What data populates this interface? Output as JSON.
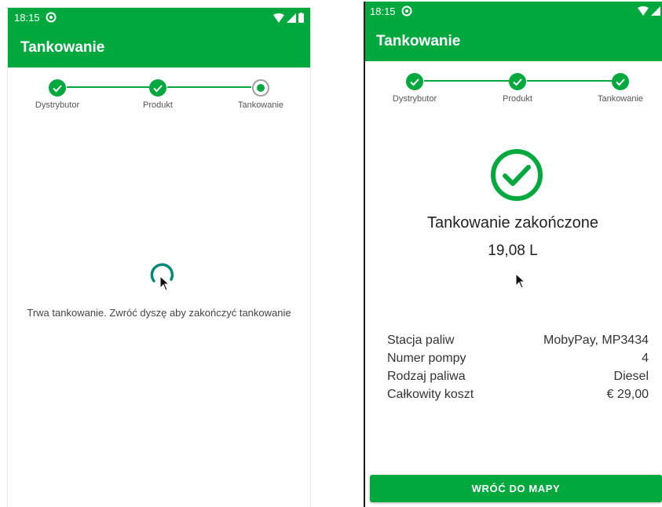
{
  "colors": {
    "primary_green": "#00a83e",
    "spinner_teal": "#00897b",
    "pending_gray": "#9e9e9e"
  },
  "left_screen": {
    "status_bar": {
      "time": "18:15"
    },
    "app_bar": {
      "title": "Tankowanie"
    },
    "stepper": {
      "steps": [
        {
          "label": "Dystrybutor",
          "state": "done"
        },
        {
          "label": "Produkt",
          "state": "done"
        },
        {
          "label": "Tankowanie",
          "state": "active"
        }
      ]
    },
    "progress_message": "Trwa tankowanie. Zwróć dyszę aby zakończyć tankowanie"
  },
  "right_screen": {
    "status_bar": {
      "time": "18:15"
    },
    "app_bar": {
      "title": "Tankowanie"
    },
    "stepper": {
      "steps": [
        {
          "label": "Dystrybutor",
          "state": "done"
        },
        {
          "label": "Produkt",
          "state": "done"
        },
        {
          "label": "Tankowanie",
          "state": "done"
        }
      ]
    },
    "completion": {
      "title": "Tankowanie zakończone",
      "volume": "19,08 L"
    },
    "details": [
      {
        "label": "Stacja paliw",
        "value": "MobyPay, MP3434"
      },
      {
        "label": "Numer pompy",
        "value": "4"
      },
      {
        "label": "Rodzaj paliwa",
        "value": "Diesel"
      },
      {
        "label": "Całkowity koszt",
        "value": "€ 29,00"
      }
    ],
    "back_button_label": "WRÓĆ DO MAPY"
  }
}
